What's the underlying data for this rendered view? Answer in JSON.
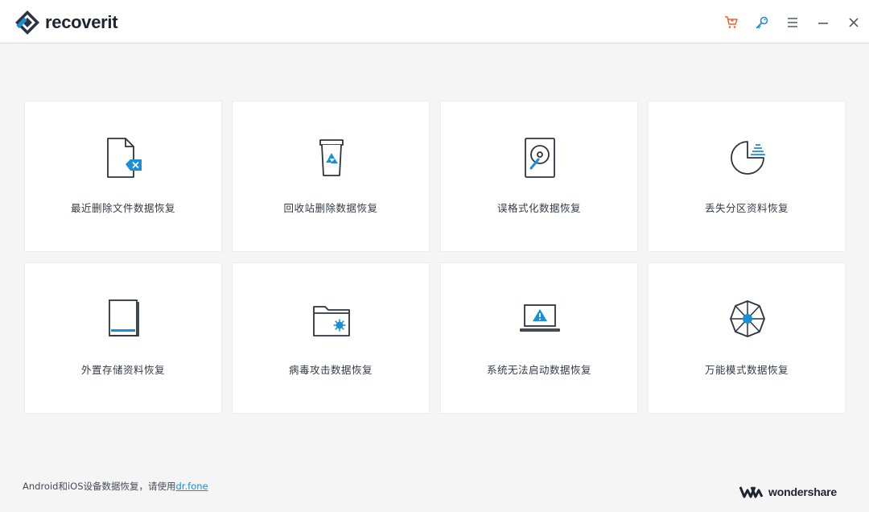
{
  "app": {
    "name": "recoverit"
  },
  "toolbar": {
    "icons": [
      "cart-icon",
      "key-icon",
      "menu-icon",
      "minimize-icon",
      "close-icon"
    ],
    "cart_color": "#f0602a",
    "key_color": "#1a8fd8"
  },
  "cards": [
    {
      "label": "最近删除文件数据恢复",
      "icon": "deleted-file-icon"
    },
    {
      "label": "回收站删除数据恢复",
      "icon": "recycle-bin-icon"
    },
    {
      "label": "误格式化数据恢复",
      "icon": "hard-drive-icon"
    },
    {
      "label": "丢失分区资料恢复",
      "icon": "partition-icon"
    },
    {
      "label": "外置存储资料恢复",
      "icon": "external-device-icon"
    },
    {
      "label": "病毒攻击数据恢复",
      "icon": "virus-folder-icon"
    },
    {
      "label": "系统无法启动数据恢复",
      "icon": "crashed-computer-icon"
    },
    {
      "label": "万能模式数据恢复",
      "icon": "all-around-icon"
    }
  ],
  "footer": {
    "note_prefix": "Android和iOS设备数据恢复，请使用",
    "link_text": "dr.fone",
    "brand": "wondershare"
  },
  "colors": {
    "accent": "#1a8fd8",
    "icon_stroke": "#2c3440"
  }
}
